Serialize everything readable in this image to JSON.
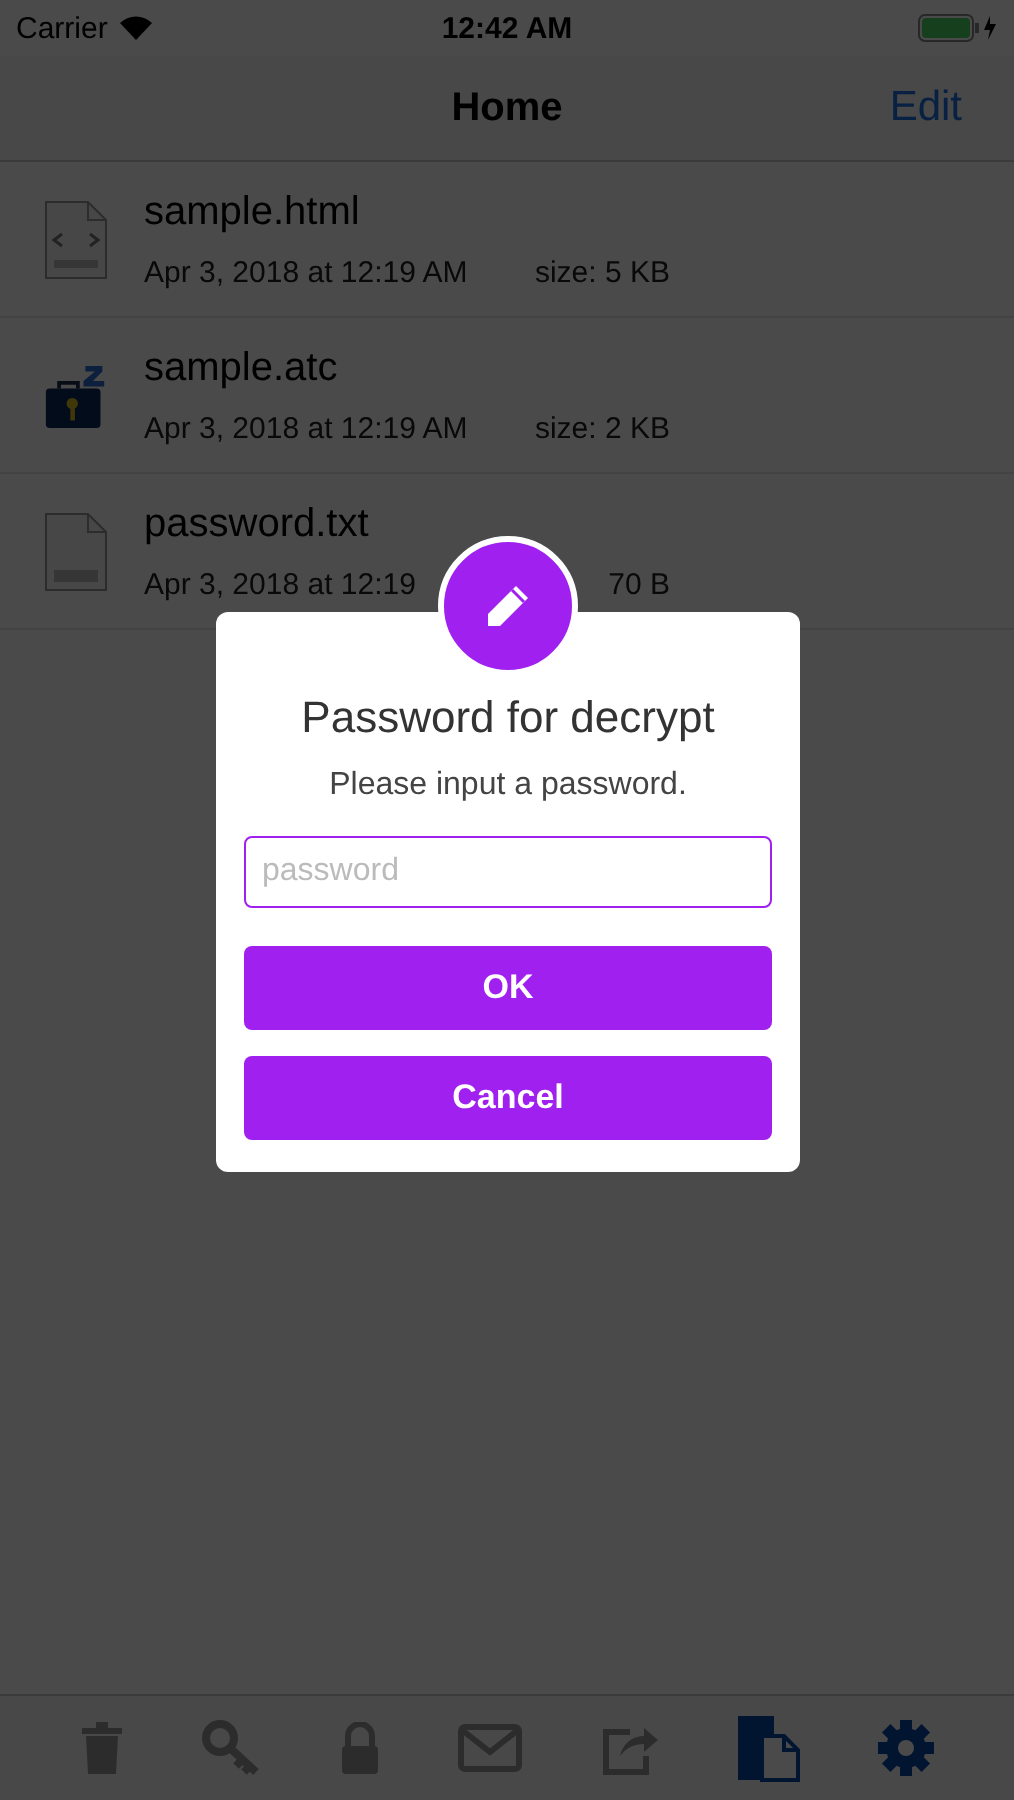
{
  "status_bar": {
    "carrier": "Carrier",
    "time": "12:42 AM"
  },
  "nav": {
    "title": "Home",
    "edit": "Edit"
  },
  "files": [
    {
      "kind": "html",
      "name": "sample.html",
      "date": "Apr 3, 2018 at 12:19 AM",
      "size": "size: 5 KB"
    },
    {
      "kind": "locked",
      "name": "sample.atc",
      "date": "Apr 3, 2018 at 12:19 AM",
      "size": "size: 2 KB"
    },
    {
      "kind": "txt",
      "name": "password.txt",
      "date": "Apr 3, 2018 at 12:19",
      "size": "70 B"
    }
  ],
  "toolbar": [
    {
      "kind": "trash",
      "disabled": true
    },
    {
      "kind": "key",
      "disabled": true
    },
    {
      "kind": "lock",
      "disabled": true
    },
    {
      "kind": "mail",
      "disabled": true
    },
    {
      "kind": "share",
      "disabled": true
    },
    {
      "kind": "files",
      "disabled": false
    },
    {
      "kind": "settings",
      "disabled": false
    }
  ],
  "dialog": {
    "title": "Password for decrypt",
    "message": "Please input a password.",
    "placeholder": "password",
    "buttons": [
      "OK",
      "Cancel"
    ]
  }
}
